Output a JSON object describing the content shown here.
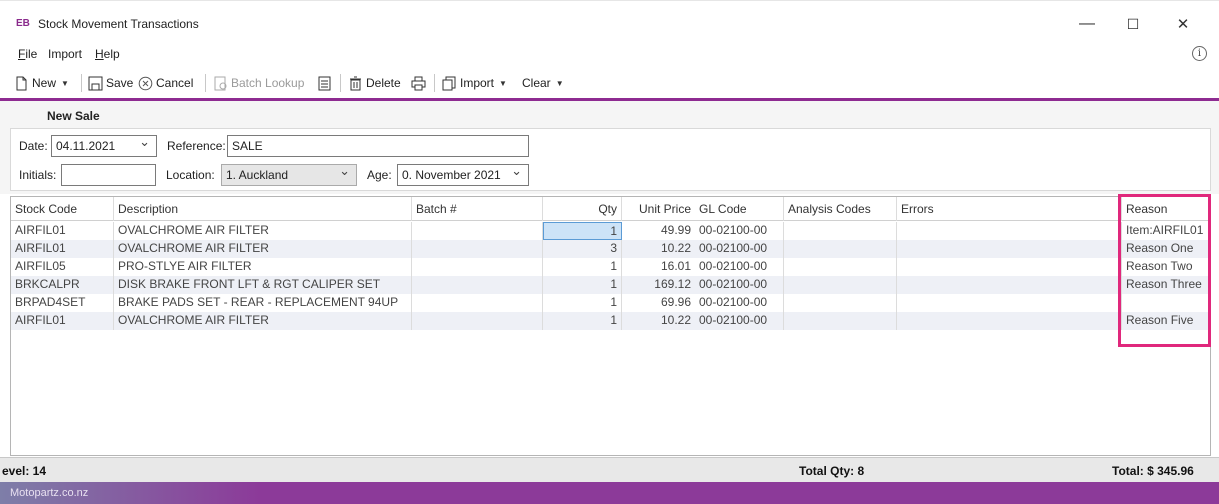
{
  "window": {
    "logo": "EB",
    "title": "Stock Movement Transactions",
    "controls": {
      "minimize": "—",
      "maximize": "☐",
      "close": "✕"
    }
  },
  "menu": {
    "items": [
      "File",
      "Import",
      "Help"
    ],
    "info_icon": "ⓘ"
  },
  "toolbar": {
    "new_label": "New",
    "save_label": "Save",
    "cancel_label": "Cancel",
    "batch_lookup_label": "Batch Lookup",
    "delete_label": "Delete",
    "import_label": "Import",
    "clear_label": "Clear"
  },
  "form": {
    "section_title": "New Sale",
    "date_label": "Date:",
    "date_value": "04.11.2021",
    "reference_label": "Reference:",
    "reference_value": "SALE",
    "initials_label": "Initials:",
    "initials_value": "",
    "location_label": "Location:",
    "location_value": "1. Auckland",
    "age_label": "Age:",
    "age_value": "0. November 2021"
  },
  "grid": {
    "columns": [
      "Stock Code",
      "Description",
      "Batch #",
      "Qty",
      "Unit Price",
      "GL Code",
      "Analysis Codes",
      "Errors",
      "Reason"
    ],
    "rows": [
      {
        "stock_code": "AIRFIL01",
        "description": "OVALCHROME AIR FILTER",
        "batch": "",
        "qty": "1",
        "unit_price": "49.99",
        "gl_code": "00-02100-00",
        "analysis": "",
        "errors": "",
        "reason": "Item:AIRFIL01"
      },
      {
        "stock_code": "AIRFIL01",
        "description": "OVALCHROME AIR FILTER",
        "batch": "",
        "qty": "3",
        "unit_price": "10.22",
        "gl_code": "00-02100-00",
        "analysis": "",
        "errors": "",
        "reason": "Reason One"
      },
      {
        "stock_code": "AIRFIL05",
        "description": "PRO-STLYE AIR FILTER",
        "batch": "",
        "qty": "1",
        "unit_price": "16.01",
        "gl_code": "00-02100-00",
        "analysis": "",
        "errors": "",
        "reason": "Reason Two"
      },
      {
        "stock_code": "BRKCALPR",
        "description": "DISK BRAKE FRONT LFT & RGT CALIPER SET",
        "batch": "",
        "qty": "1",
        "unit_price": "169.12",
        "gl_code": "00-02100-00",
        "analysis": "",
        "errors": "",
        "reason": "Reason Three"
      },
      {
        "stock_code": "BRPAD4SET",
        "description": "BRAKE PADS SET - REAR - REPLACEMENT 94UP",
        "batch": "",
        "qty": "1",
        "unit_price": "69.96",
        "gl_code": "00-02100-00",
        "analysis": "",
        "errors": "",
        "reason": ""
      },
      {
        "stock_code": "AIRFIL01",
        "description": "OVALCHROME AIR FILTER",
        "batch": "",
        "qty": "1",
        "unit_price": "10.22",
        "gl_code": "00-02100-00",
        "analysis": "",
        "errors": "",
        "reason": "Reason Five"
      }
    ]
  },
  "status": {
    "level_text": "evel:  14",
    "total_qty_text": "Total Qty:  8",
    "total_text": "Total: $ 345.96"
  },
  "footer": {
    "brand": "Motopartz.co.nz"
  },
  "colors": {
    "accent": "#8e2b91",
    "highlight": "#e0287c",
    "footer": "#8c3a99"
  }
}
